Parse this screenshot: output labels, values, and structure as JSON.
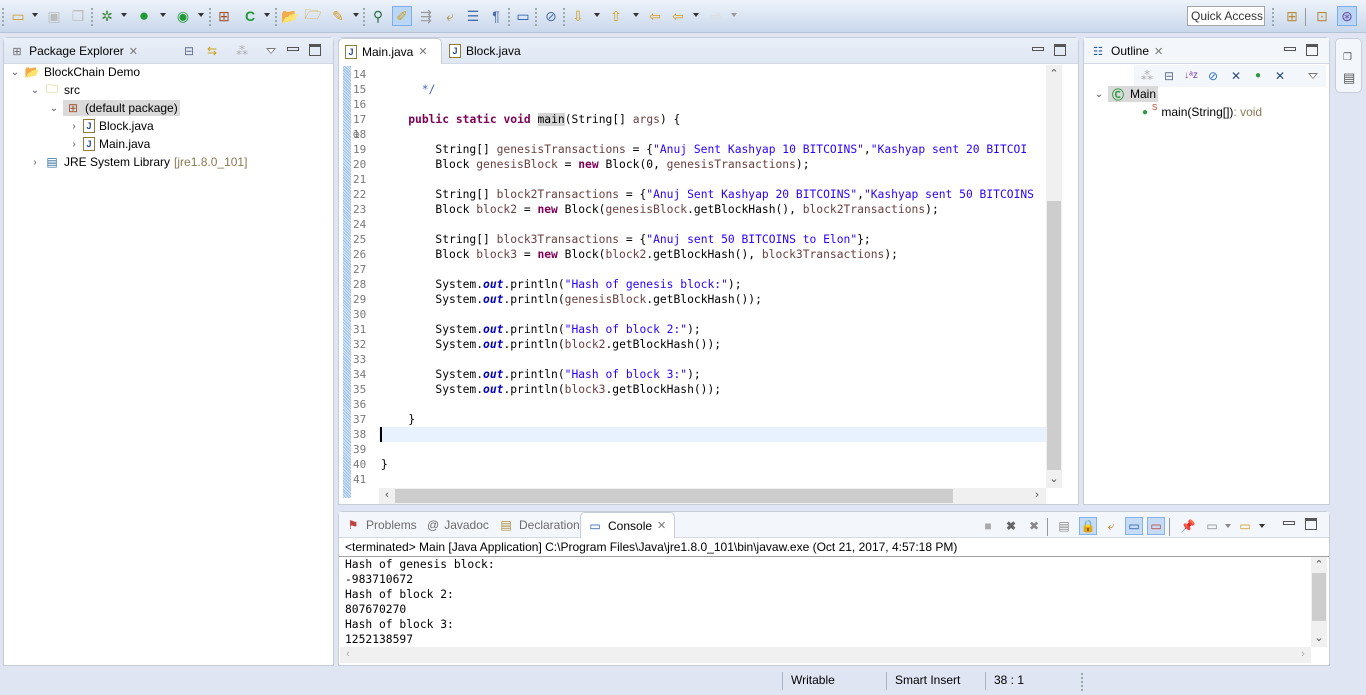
{
  "toolbar": {
    "icons": [
      "new-icon",
      "save-icon",
      "save-all-icon",
      "debug-icon",
      "run-icon",
      "external-tools-icon",
      "new-java-package-icon",
      "new-java-class-icon",
      "open-type-icon",
      "open-task-icon",
      "search-icon",
      "open-type-hierarchy-icon",
      "mark-occurrences-icon",
      "word-wrap-icon",
      "toggle-block-selection-icon",
      "show-whitespace-icon",
      "show-source-icon",
      "skip-breakpoints-icon",
      "next-annotation-icon",
      "previous-annotation-icon",
      "last-edit-location-icon",
      "back-icon",
      "forward-icon"
    ],
    "quick_access": "Quick Access",
    "perspectives": [
      "open-perspective-icon",
      "resource-perspective-icon",
      "java-perspective-icon"
    ]
  },
  "package_explorer": {
    "title": "Package Explorer",
    "tree": [
      {
        "label": "BlockChain Demo",
        "icon": "project-icon",
        "expanded": true
      },
      {
        "label": "src",
        "icon": "source-folder-icon",
        "expanded": true
      },
      {
        "label": "(default package)",
        "icon": "package-icon",
        "expanded": true,
        "selected": true
      },
      {
        "label": "Block.java",
        "icon": "java-file-icon",
        "expanded": false
      },
      {
        "label": "Main.java",
        "icon": "java-file-icon",
        "expanded": false
      },
      {
        "label": "JRE System Library",
        "suffix": "[jre1.8.0_101]",
        "icon": "library-icon",
        "expanded": false
      }
    ]
  },
  "editor": {
    "tabs": [
      {
        "label": "Main.java",
        "active": true
      },
      {
        "label": "Block.java",
        "active": false
      }
    ],
    "lines": [
      {
        "n": "14",
        "code": ""
      },
      {
        "n": "15",
        "code": "      */"
      },
      {
        "n": "16",
        "code": ""
      },
      {
        "n": "17",
        "code": "    public static void main(String[] args) {"
      },
      {
        "n": "18",
        "code": ""
      },
      {
        "n": "19",
        "code": "        String[] genesisTransactions = {\"Anuj Sent Kashyap 10 BITCOINS\",\"Kashyap sent 20 BITCOI"
      },
      {
        "n": "20",
        "code": "        Block genesisBlock = new Block(0, genesisTransactions);"
      },
      {
        "n": "21",
        "code": ""
      },
      {
        "n": "22",
        "code": "        String[] block2Transactions = {\"Anuj Sent Kashyap 20 BITCOINS\",\"Kashyap sent 50 BITCOINS"
      },
      {
        "n": "23",
        "code": "        Block block2 = new Block(genesisBlock.getBlockHash(), block2Transactions);"
      },
      {
        "n": "24",
        "code": ""
      },
      {
        "n": "25",
        "code": "        String[] block3Transactions = {\"Anuj sent 50 BITCOINS to Elon\"};"
      },
      {
        "n": "26",
        "code": "        Block block3 = new Block(block2.getBlockHash(), block3Transactions);"
      },
      {
        "n": "27",
        "code": ""
      },
      {
        "n": "28",
        "code": "        System.out.println(\"Hash of genesis block:\");"
      },
      {
        "n": "29",
        "code": "        System.out.println(genesisBlock.getBlockHash());"
      },
      {
        "n": "30",
        "code": ""
      },
      {
        "n": "31",
        "code": "        System.out.println(\"Hash of block 2:\");"
      },
      {
        "n": "32",
        "code": "        System.out.println(block2.getBlockHash());"
      },
      {
        "n": "33",
        "code": ""
      },
      {
        "n": "34",
        "code": "        System.out.println(\"Hash of block 3:\");"
      },
      {
        "n": "35",
        "code": "        System.out.println(block3.getBlockHash());"
      },
      {
        "n": "36",
        "code": ""
      },
      {
        "n": "37",
        "code": "    }"
      },
      {
        "n": "38",
        "code": ""
      },
      {
        "n": "39",
        "code": ""
      },
      {
        "n": "40",
        "code": "}"
      },
      {
        "n": "41",
        "code": ""
      }
    ],
    "current_line": "38"
  },
  "outline": {
    "title": "Outline",
    "class_name": "Main",
    "method": "main(String[])",
    "method_return": " : void"
  },
  "bottom_panel": {
    "tabs": [
      {
        "label": "Problems",
        "icon": "problems-icon",
        "active": false
      },
      {
        "label": "Javadoc",
        "icon": "javadoc-icon",
        "active": false
      },
      {
        "label": "Declaration",
        "icon": "declaration-icon",
        "active": false
      },
      {
        "label": "Console",
        "icon": "console-icon",
        "active": true
      }
    ],
    "console_header": "<terminated> Main [Java Application] C:\\Program Files\\Java\\jre1.8.0_101\\bin\\javaw.exe (Oct 21, 2017, 4:57:18 PM)",
    "output": [
      "Hash of genesis block:",
      "-983710672",
      "Hash of block 2:",
      "807670270",
      "Hash of block 3:",
      "1252138597"
    ]
  },
  "status_bar": {
    "writable": "Writable",
    "insert_mode": "Smart Insert",
    "position": "38 : 1"
  }
}
